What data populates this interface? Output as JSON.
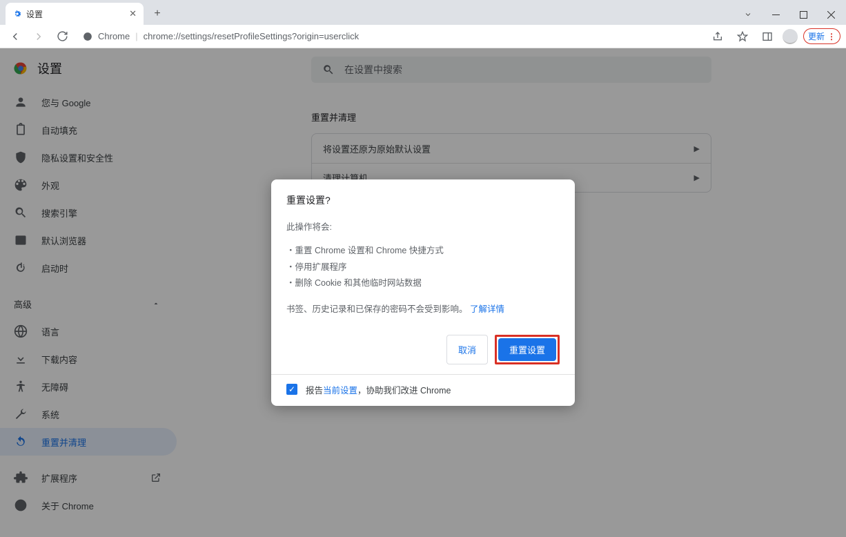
{
  "tab": {
    "title": "设置"
  },
  "toolbar": {
    "app_label": "Chrome",
    "url": "chrome://settings/resetProfileSettings?origin=userclick",
    "update_label": "更新"
  },
  "app": {
    "title": "设置"
  },
  "search": {
    "placeholder": "在设置中搜索"
  },
  "sidebar": {
    "items": [
      {
        "label": "您与 Google"
      },
      {
        "label": "自动填充"
      },
      {
        "label": "隐私设置和安全性"
      },
      {
        "label": "外观"
      },
      {
        "label": "搜索引擎"
      },
      {
        "label": "默认浏览器"
      },
      {
        "label": "启动时"
      }
    ],
    "advanced_label": "高级",
    "adv_items": [
      {
        "label": "语言"
      },
      {
        "label": "下载内容"
      },
      {
        "label": "无障碍"
      },
      {
        "label": "系统"
      },
      {
        "label": "重置并清理"
      }
    ],
    "footer": [
      {
        "label": "扩展程序"
      },
      {
        "label": "关于 Chrome"
      }
    ]
  },
  "section": {
    "title": "重置并清理",
    "rows": [
      {
        "label": "将设置还原为原始默认设置"
      },
      {
        "label": "清理计算机"
      }
    ]
  },
  "dialog": {
    "title": "重置设置?",
    "intro": "此操作将会:",
    "bullets": [
      "重置 Chrome 设置和 Chrome 快捷方式",
      "停用扩展程序",
      "删除 Cookie 和其他临时网站数据"
    ],
    "note_before": "书签、历史记录和已保存的密码不会受到影响。",
    "link": "了解详情",
    "cancel": "取消",
    "confirm": "重置设置",
    "report_prefix": "报告",
    "report_link": "当前设置",
    "report_suffix": "，协助我们改进 Chrome"
  }
}
